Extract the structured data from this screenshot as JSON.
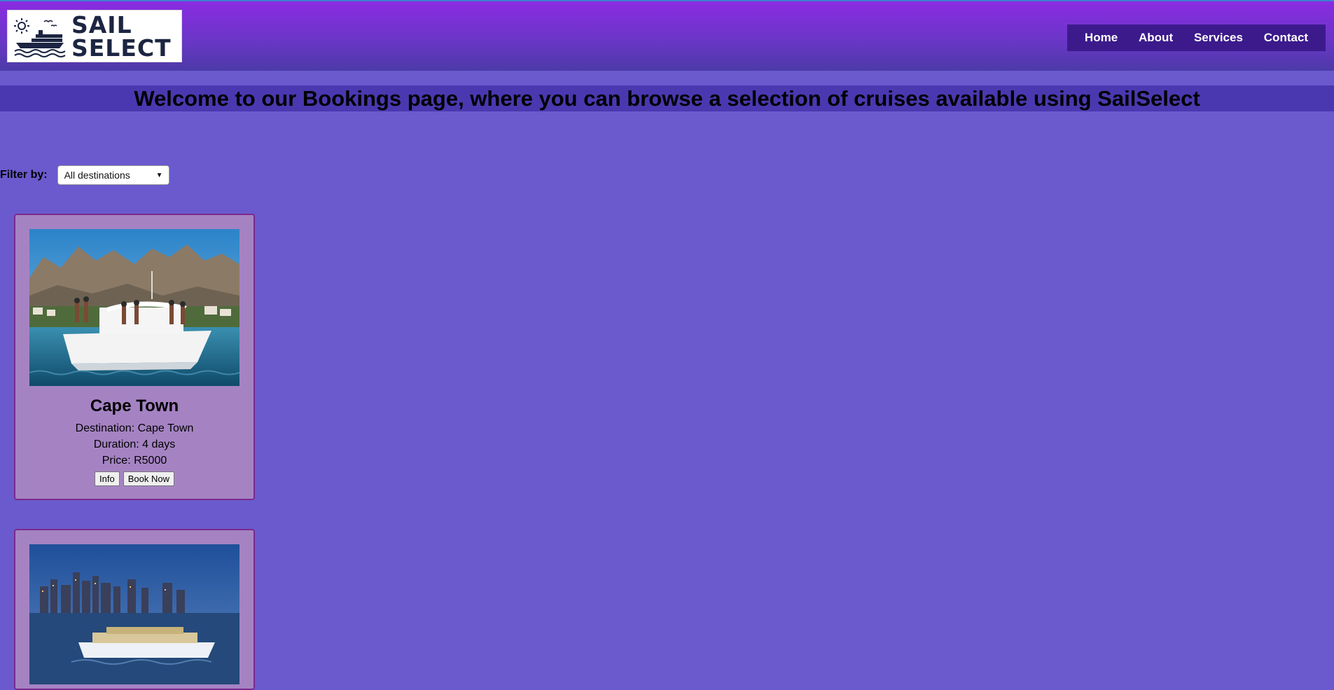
{
  "brand": {
    "logo_line1": "SAIL",
    "logo_line2": "SELECT"
  },
  "nav": {
    "items": [
      {
        "label": "Home"
      },
      {
        "label": "About"
      },
      {
        "label": "Services"
      },
      {
        "label": "Contact"
      }
    ]
  },
  "banner": {
    "text": "Welcome to our Bookings page, where you can browse a selection of cruises available using SailSelect"
  },
  "filter": {
    "label": "Filter by:",
    "selected": "All destinations"
  },
  "cruises": [
    {
      "title": "Cape Town",
      "destination": "Destination: Cape Town",
      "duration": "Duration: 4 days",
      "price": "Price: R5000",
      "info_label": "Info",
      "book_label": "Book Now"
    }
  ],
  "colors": {
    "page_bg": "#6a5acd",
    "header_top": "#8a2be2",
    "nav_bg": "#3c1a8c",
    "banner_bg": "#4a38b0",
    "card_bg": "#a583c3",
    "card_border": "#7b2a8c"
  }
}
